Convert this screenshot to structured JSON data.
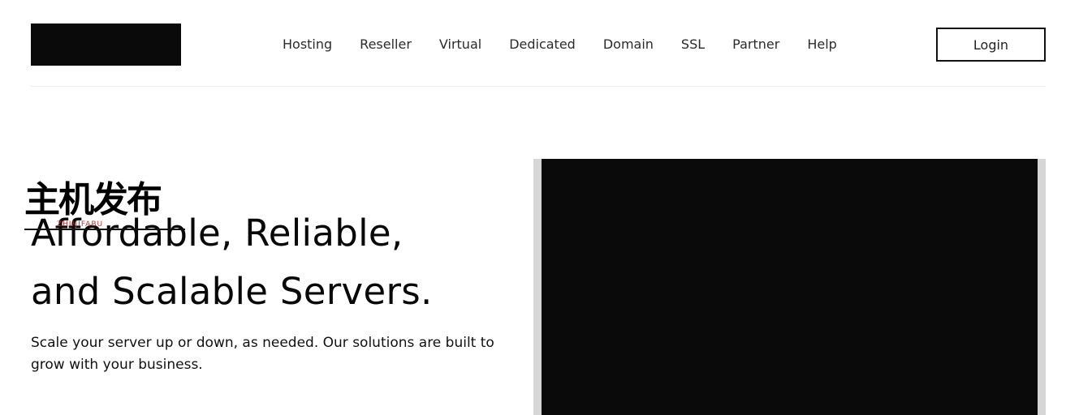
{
  "header": {
    "logo_color": "#0a0a0a",
    "nav": [
      {
        "label": "Hosting"
      },
      {
        "label": "Reseller"
      },
      {
        "label": "Virtual"
      },
      {
        "label": "Dedicated"
      },
      {
        "label": "Domain"
      },
      {
        "label": "SSL"
      },
      {
        "label": "Partner"
      },
      {
        "label": "Help"
      }
    ],
    "login_label": "Login"
  },
  "hero": {
    "headline_line1": "Affordable, Reliable,",
    "headline_line2": "and Scalable Servers.",
    "subtitle": "Scale your server up or down, as needed. Our solutions are built to grow with your business.",
    "media_color": "#0a0a0a"
  },
  "watermark": {
    "text": "主机发布",
    "subtext": "ZHUJIFABU"
  }
}
